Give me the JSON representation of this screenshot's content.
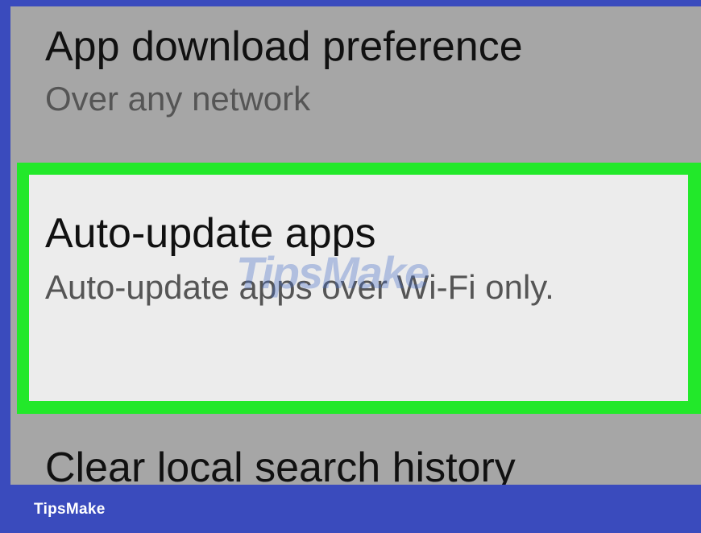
{
  "settings": {
    "download_preference": {
      "title": "App download preference",
      "summary": "Over any network"
    },
    "auto_update": {
      "title": "Auto-update apps",
      "summary": "Auto-update apps over Wi-Fi only."
    },
    "clear_history": {
      "title": "Clear local search history"
    }
  },
  "watermark": "TipsMake",
  "brand": "TipsMake",
  "colors": {
    "frame": "#3a4bbd",
    "screen_background": "#a6a6a6",
    "highlight": "#22e82a",
    "selected_item_background": "#ececec"
  }
}
